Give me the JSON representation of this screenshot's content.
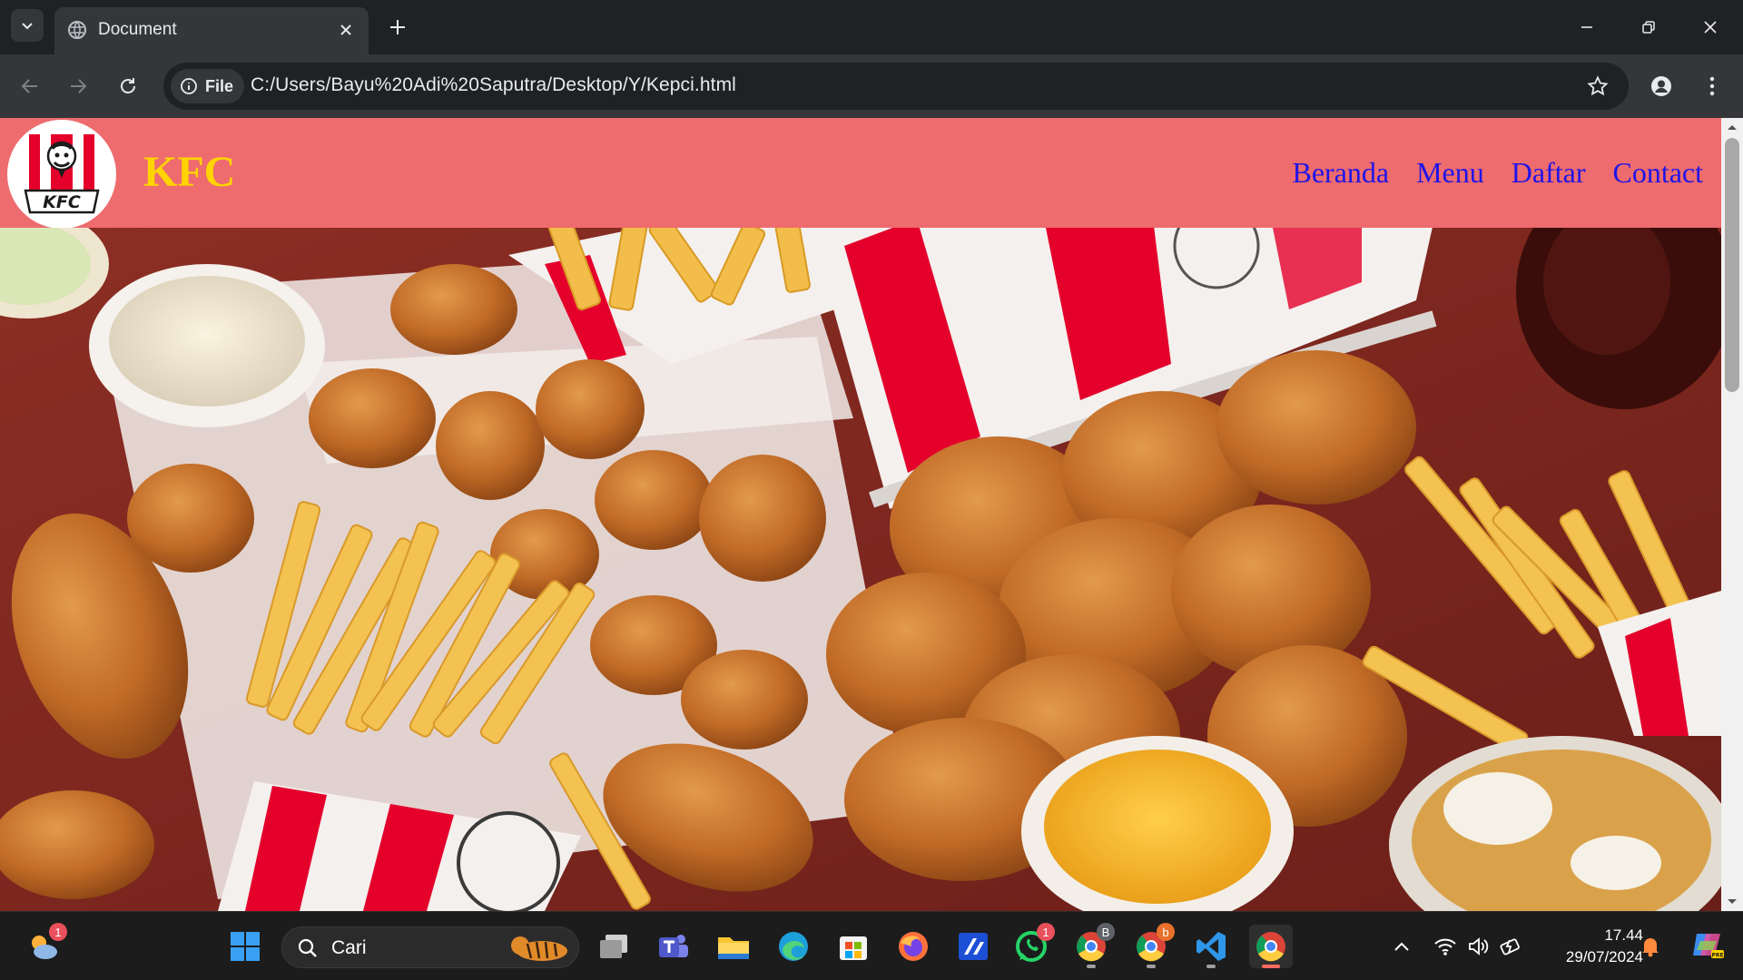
{
  "browser": {
    "tab": {
      "title": "Document"
    },
    "address": {
      "chip_label": "File",
      "url": "C:/Users/Bayu%20Adi%20Saputra/Desktop/Y/Kepci.html"
    }
  },
  "site": {
    "brand": "KFC",
    "logo_text": "KFC",
    "nav": [
      "Beranda",
      "Menu",
      "Daftar",
      "Contact"
    ],
    "colors": {
      "header_bg": "#ee6b6e",
      "brand": "#ffd400",
      "nav_link": "#1f14e8"
    }
  },
  "taskbar": {
    "search_placeholder": "Cari",
    "clock": {
      "time": "17.44",
      "date": "29/07/2024"
    },
    "badges": {
      "weather": "1",
      "whatsapp": "1",
      "chrome_b": "B",
      "chrome_c": "b"
    }
  }
}
